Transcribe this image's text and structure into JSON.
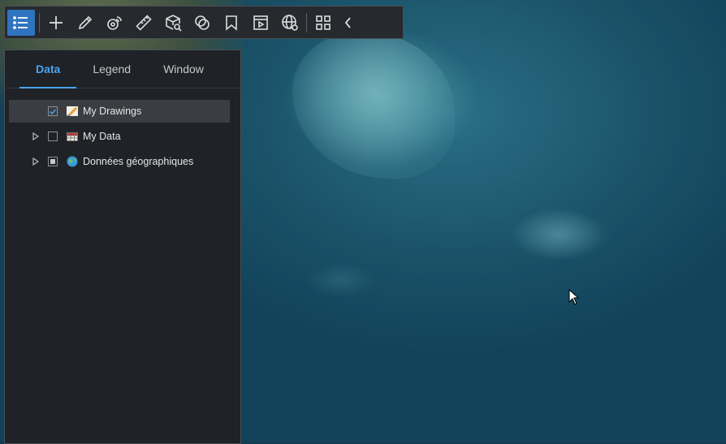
{
  "toolbar": {
    "buttons": [
      {
        "name": "layers-list-icon",
        "active": true
      },
      {
        "name": "add-icon"
      },
      {
        "name": "draw-pencil-icon"
      },
      {
        "name": "analysis-tools-icon"
      },
      {
        "name": "measure-ruler-icon"
      },
      {
        "name": "3d-box-query-icon"
      },
      {
        "name": "overlay-layers-icon"
      },
      {
        "name": "bookmark-icon"
      },
      {
        "name": "presentation-icon"
      },
      {
        "name": "globe-settings-icon"
      },
      {
        "name": "apps-grid-icon"
      },
      {
        "name": "collapse-chevron-icon"
      }
    ],
    "accent": "#2f74c0"
  },
  "panel": {
    "tabs": [
      {
        "label": "Data",
        "active": true
      },
      {
        "label": "Legend",
        "active": false
      },
      {
        "label": "Window",
        "active": false
      }
    ],
    "tree": [
      {
        "label": "My Drawings",
        "checked": "checked",
        "icon": "drawing-layer-icon",
        "expandable": false,
        "selected": true
      },
      {
        "label": "My Data",
        "checked": "unchecked",
        "icon": "table-data-icon",
        "expandable": true,
        "selected": false
      },
      {
        "label": "Données géographiques",
        "checked": "partial",
        "icon": "globe-data-icon",
        "expandable": true,
        "selected": false
      }
    ],
    "tab_accent": "#4aa3f0"
  }
}
